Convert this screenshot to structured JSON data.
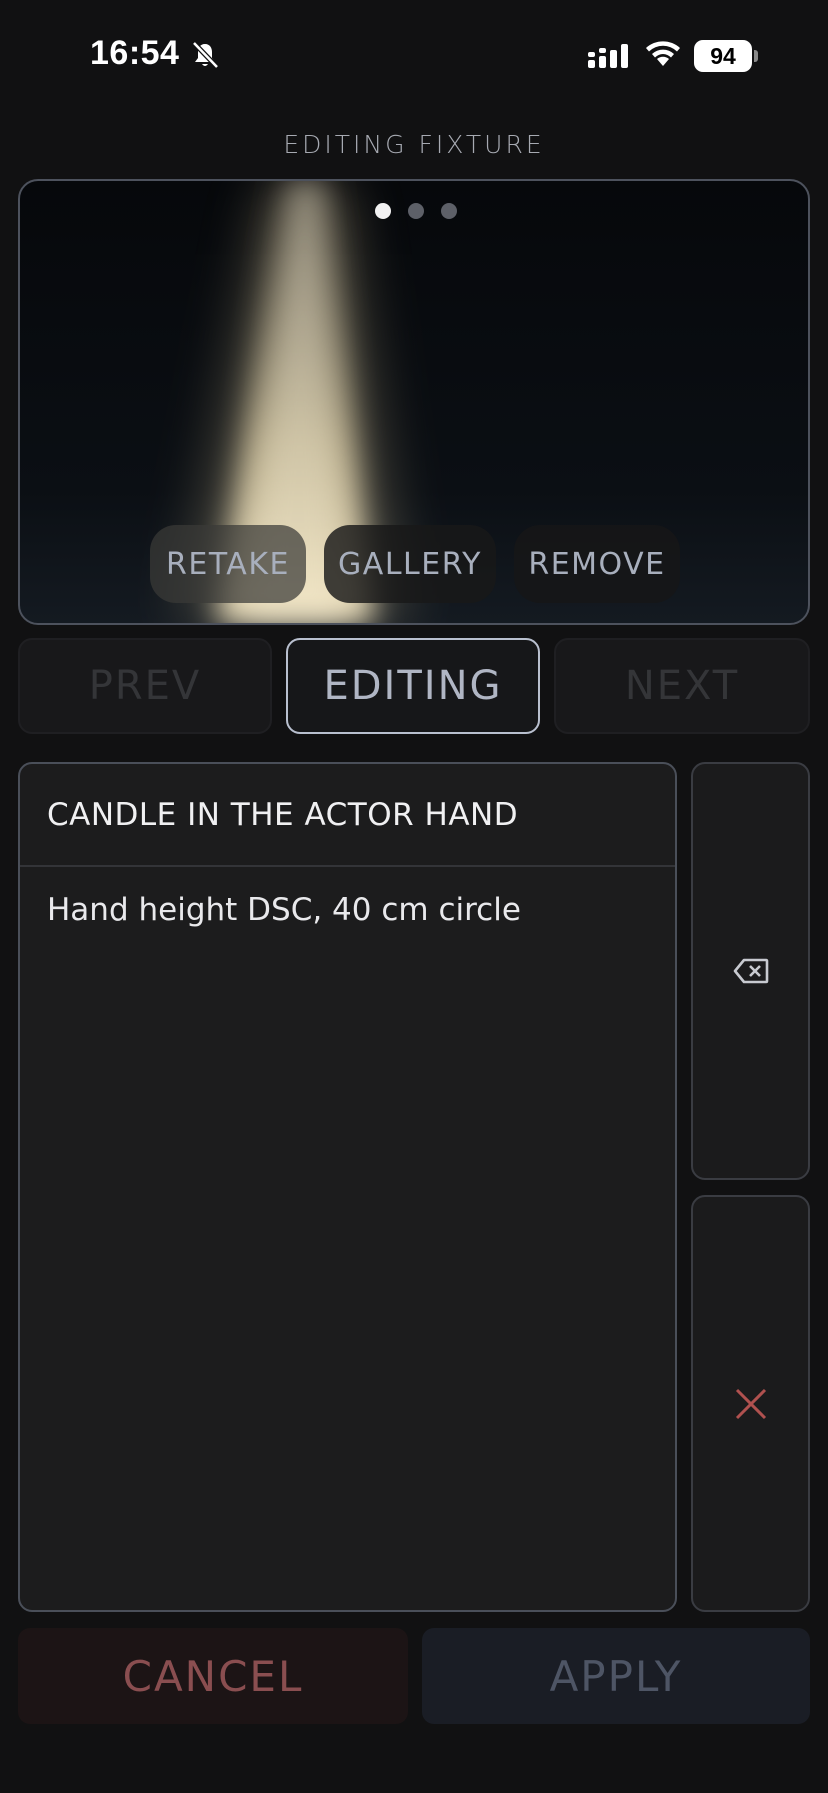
{
  "status_bar": {
    "time": "16:54",
    "battery": "94",
    "icons": [
      "bell-slash-icon",
      "cellular-signal-icon",
      "wifi-icon",
      "battery-icon"
    ]
  },
  "screen_title": "EDITING FIXTURE",
  "photo": {
    "page_count": 3,
    "active_page": 1,
    "buttons": {
      "retake": "RETAKE",
      "gallery": "GALLERY",
      "remove": "REMOVE"
    }
  },
  "nav": {
    "prev": "PREV",
    "current": "EDITING",
    "next": "NEXT"
  },
  "note": {
    "title": "CANDLE IN THE ACTOR HAND",
    "body": "Hand height DSC, 40 cm circle"
  },
  "side_actions": {
    "backspace_icon": "backspace-icon",
    "close_icon": "close-icon"
  },
  "actions": {
    "cancel": "CANCEL",
    "apply": "APPLY"
  },
  "colors": {
    "cancel_text": "#8a4e50",
    "apply_text": "#4e5565",
    "close_x": "#b0514f",
    "accent_border": "#b9c0cf"
  }
}
